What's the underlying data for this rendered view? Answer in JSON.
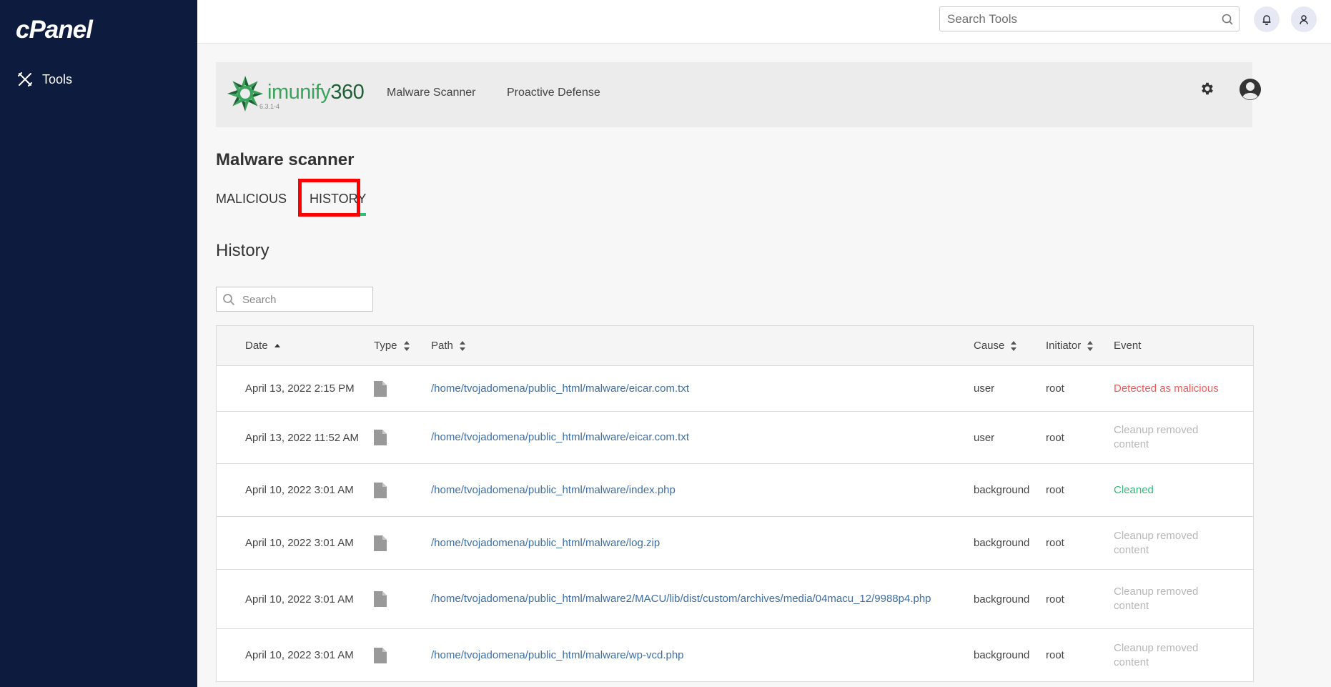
{
  "sidebar": {
    "logo": "cPanel",
    "items": [
      {
        "label": "Tools",
        "icon": "tools-icon"
      }
    ]
  },
  "topbar": {
    "search_placeholder": "Search Tools"
  },
  "plugin": {
    "brand": "imunify",
    "brand_number": "360",
    "version": "6.3.1-4",
    "nav": [
      "Malware Scanner",
      "Proactive Defense"
    ]
  },
  "page": {
    "title": "Malware scanner",
    "tabs": [
      "MALICIOUS",
      "HISTORY"
    ],
    "active_tab": "HISTORY",
    "section_title": "History",
    "search_placeholder": "Search"
  },
  "table": {
    "columns": [
      "Date",
      "Type",
      "Path",
      "Cause",
      "Initiator",
      "Event"
    ],
    "rows": [
      {
        "date": "April 13, 2022 2:15 PM",
        "type": "file-icon",
        "path": "/home/tvojadomena/public_html/malware/eicar.com.txt",
        "cause": "user",
        "initiator": "root",
        "event": "Detected as malicious",
        "event_status": "malicious"
      },
      {
        "date": "April 13, 2022 11:52 AM",
        "type": "file-icon",
        "path": "/home/tvojadomena/public_html/malware/eicar.com.txt",
        "cause": "user",
        "initiator": "root",
        "event": "Cleanup removed content",
        "event_status": "removed"
      },
      {
        "date": "April 10, 2022 3:01 AM",
        "type": "file-icon",
        "path": "/home/tvojadomena/public_html/malware/index.php",
        "cause": "background",
        "initiator": "root",
        "event": "Cleaned",
        "event_status": "cleaned"
      },
      {
        "date": "April 10, 2022 3:01 AM",
        "type": "file-icon",
        "path": "/home/tvojadomena/public_html/malware/log.zip",
        "cause": "background",
        "initiator": "root",
        "event": "Cleanup removed content",
        "event_status": "removed"
      },
      {
        "date": "April 10, 2022 3:01 AM",
        "type": "file-icon",
        "path": "/home/tvojadomena/public_html/malware2/MACU/lib/dist/custom/archives/media/04macu_12/9988p4.php",
        "cause": "background",
        "initiator": "root",
        "event": "Cleanup removed content",
        "event_status": "removed"
      },
      {
        "date": "April 10, 2022 3:01 AM",
        "type": "file-icon",
        "path": "/home/tvojadomena/public_html/malware/wp-vcd.php",
        "cause": "background",
        "initiator": "root",
        "event": "Cleanup removed content",
        "event_status": "removed"
      }
    ]
  },
  "colors": {
    "sidebar_bg": "#0c1b3e",
    "accent_green": "#2fbd7a",
    "malicious_red": "#f35b5b",
    "link_blue": "#3d6ea5",
    "highlight_red": "#ff0000"
  }
}
